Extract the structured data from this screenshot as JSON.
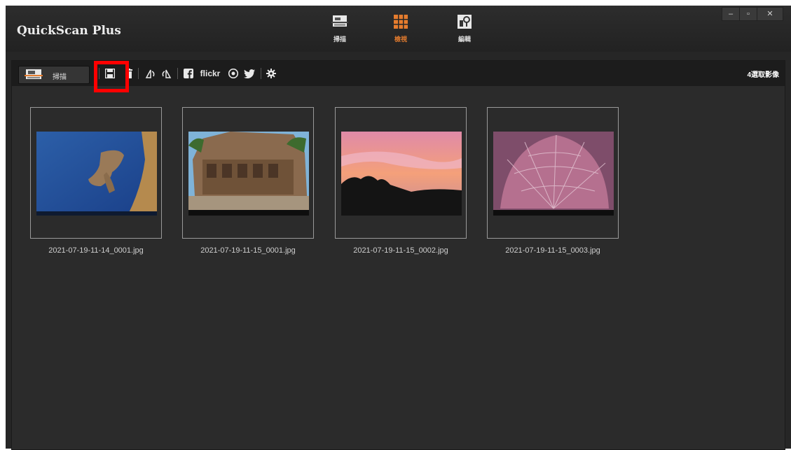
{
  "app": {
    "title": "QuickScan Plus"
  },
  "mode_tabs": [
    {
      "label": "掃描",
      "icon": "scanner-icon",
      "active": false
    },
    {
      "label": "檢視",
      "icon": "grid-view-icon",
      "active": true
    },
    {
      "label": "編輯",
      "icon": "edit-tools-icon",
      "active": false
    }
  ],
  "window_controls": {
    "minimize": "–",
    "maximize": "▫",
    "close": "✕"
  },
  "toolbar": {
    "scan_label": "掃描",
    "flickr_label": "flickr",
    "selected_count": "4選取影像",
    "icons": [
      "save-icon",
      "trash-icon",
      "rotate-left-icon",
      "rotate-right-icon",
      "facebook-icon",
      "flickr-icon",
      "picasa-icon",
      "twitter-icon",
      "settings-gear-icon"
    ]
  },
  "thumbnails": [
    {
      "filename": "2021-07-19-11-14_0001.jpg"
    },
    {
      "filename": "2021-07-19-11-15_0001.jpg"
    },
    {
      "filename": "2021-07-19-11-15_0002.jpg"
    },
    {
      "filename": "2021-07-19-11-15_0003.jpg"
    }
  ],
  "colors": {
    "accent": "#e57c2e",
    "highlight": "#ff0000",
    "background": "#262626"
  }
}
